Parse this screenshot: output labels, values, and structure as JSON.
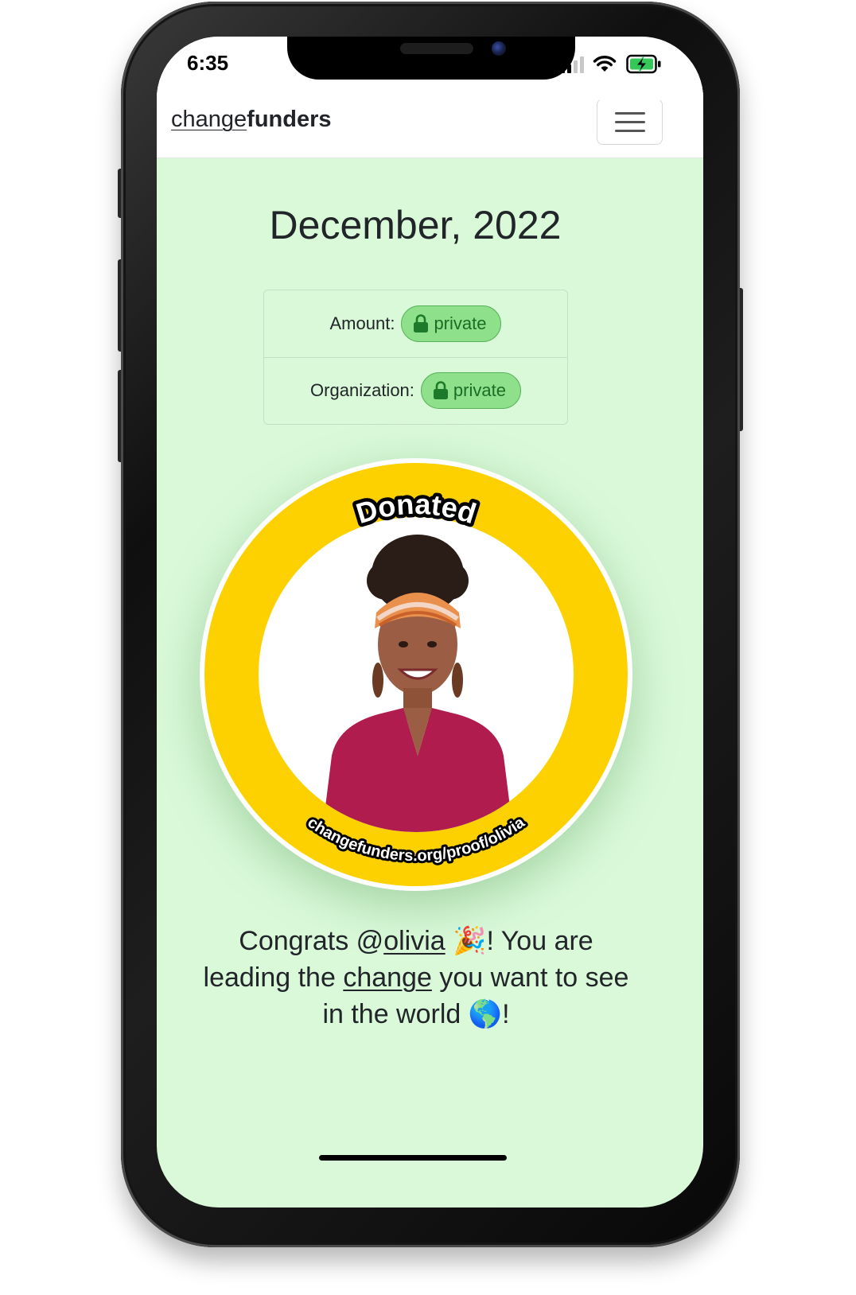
{
  "status_bar": {
    "time": "6:35"
  },
  "navbar": {
    "brand_part1": "change",
    "brand_part2": "funders",
    "menu_icon": "hamburger-icon"
  },
  "main": {
    "title": "December, 2022",
    "details": [
      {
        "label": "Amount:",
        "badge": "private",
        "badge_icon": "lock-icon"
      },
      {
        "label": "Organization:",
        "badge": "private",
        "badge_icon": "lock-icon"
      }
    ],
    "badge_image": {
      "top_text": "Donated",
      "bottom_text": "changefunders.org/proof/olivia",
      "ring_color": "#fdd100"
    },
    "congrats": {
      "part1": "Congrats @",
      "username": "olivia",
      "party_emoji": "🎉",
      "part2": "! You are leading the ",
      "link": "change",
      "part3": " you want to see in the world ",
      "globe_emoji": "🌎",
      "part4": "!"
    }
  },
  "colors": {
    "page_background": "#daf9d9",
    "badge_green": "#8fe08a",
    "badge_text": "#1a6d25"
  }
}
